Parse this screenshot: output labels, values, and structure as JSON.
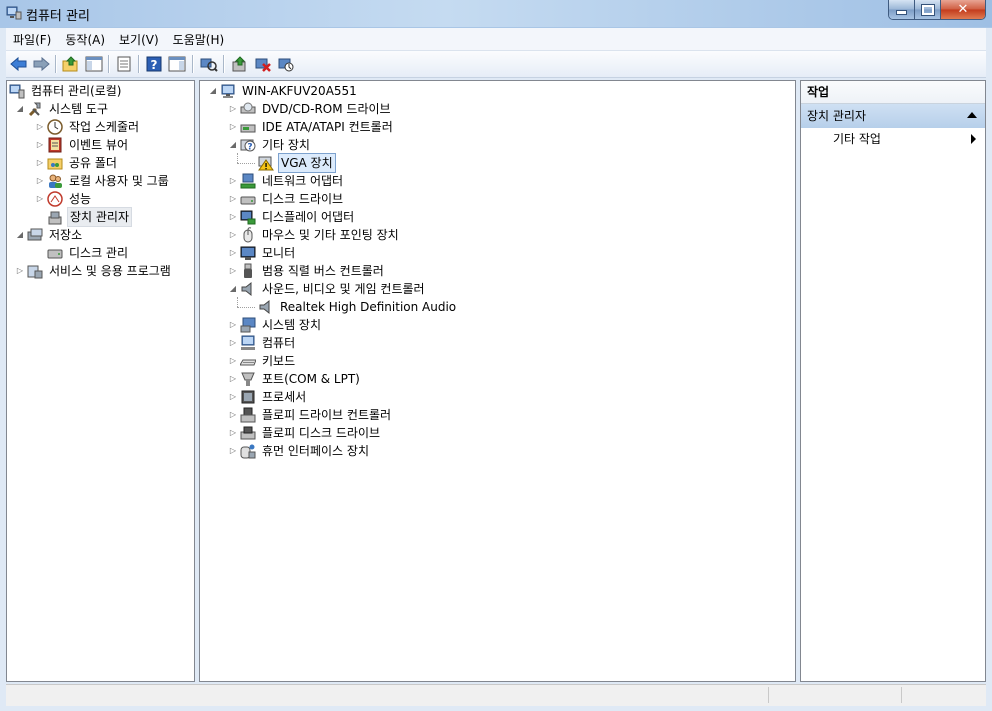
{
  "window": {
    "title": "컴퓨터 관리",
    "buttons": [
      "minimize",
      "maximize",
      "close"
    ]
  },
  "menu": [
    {
      "label": "파일(F)"
    },
    {
      "label": "동작(A)"
    },
    {
      "label": "보기(V)"
    },
    {
      "label": "도움말(H)"
    }
  ],
  "toolbar": {
    "buttons": [
      "back-arrow-icon",
      "forward-arrow-icon",
      "up-folder-icon",
      "show-hide-tree-icon",
      "properties-icon",
      "help-icon",
      "show-hide-action-icon",
      "scan-hardware-icon",
      "update-driver-icon",
      "uninstall-icon",
      "disable-icon"
    ]
  },
  "left_tree": {
    "root": "컴퓨터 관리(로컬)",
    "system_tools": "시스템 도구",
    "task_scheduler": "작업 스케줄러",
    "event_viewer": "이벤트 뷰어",
    "shared_folders": "공유 폴더",
    "local_users": "로컬 사용자 및 그룹",
    "performance": "성능",
    "device_manager": "장치 관리자",
    "storage": "저장소",
    "disk_management": "디스크 관리",
    "services": "서비스 및 응용 프로그램"
  },
  "device_tree": {
    "computer_name": "WIN-AKFUV20A551",
    "dvd": "DVD/CD-ROM 드라이브",
    "ide": "IDE ATA/ATAPI 컨트롤러",
    "other_devices": "기타 장치",
    "vga": "VGA 장치",
    "network": "네트워크 어댑터",
    "disk_drives": "디스크 드라이브",
    "display": "디스플레이 어댑터",
    "mouse": "마우스 및 기타 포인팅 장치",
    "monitor": "모니터",
    "usb": "범용 직렬 버스 컨트롤러",
    "sound": "사운드, 비디오 및 게임 컨트롤러",
    "realtek": "Realtek High Definition Audio",
    "system_devices": "시스템 장치",
    "computer": "컴퓨터",
    "keyboard": "키보드",
    "ports": "포트(COM & LPT)",
    "processor": "프로세서",
    "floppy_ctrl": "플로피 드라이브 컨트롤러",
    "floppy_disk": "플로피 디스크 드라이브",
    "hid": "휴먼 인터페이스 장치"
  },
  "actions": {
    "header": "작업",
    "section": "장치 관리자",
    "item": "기타 작업"
  }
}
